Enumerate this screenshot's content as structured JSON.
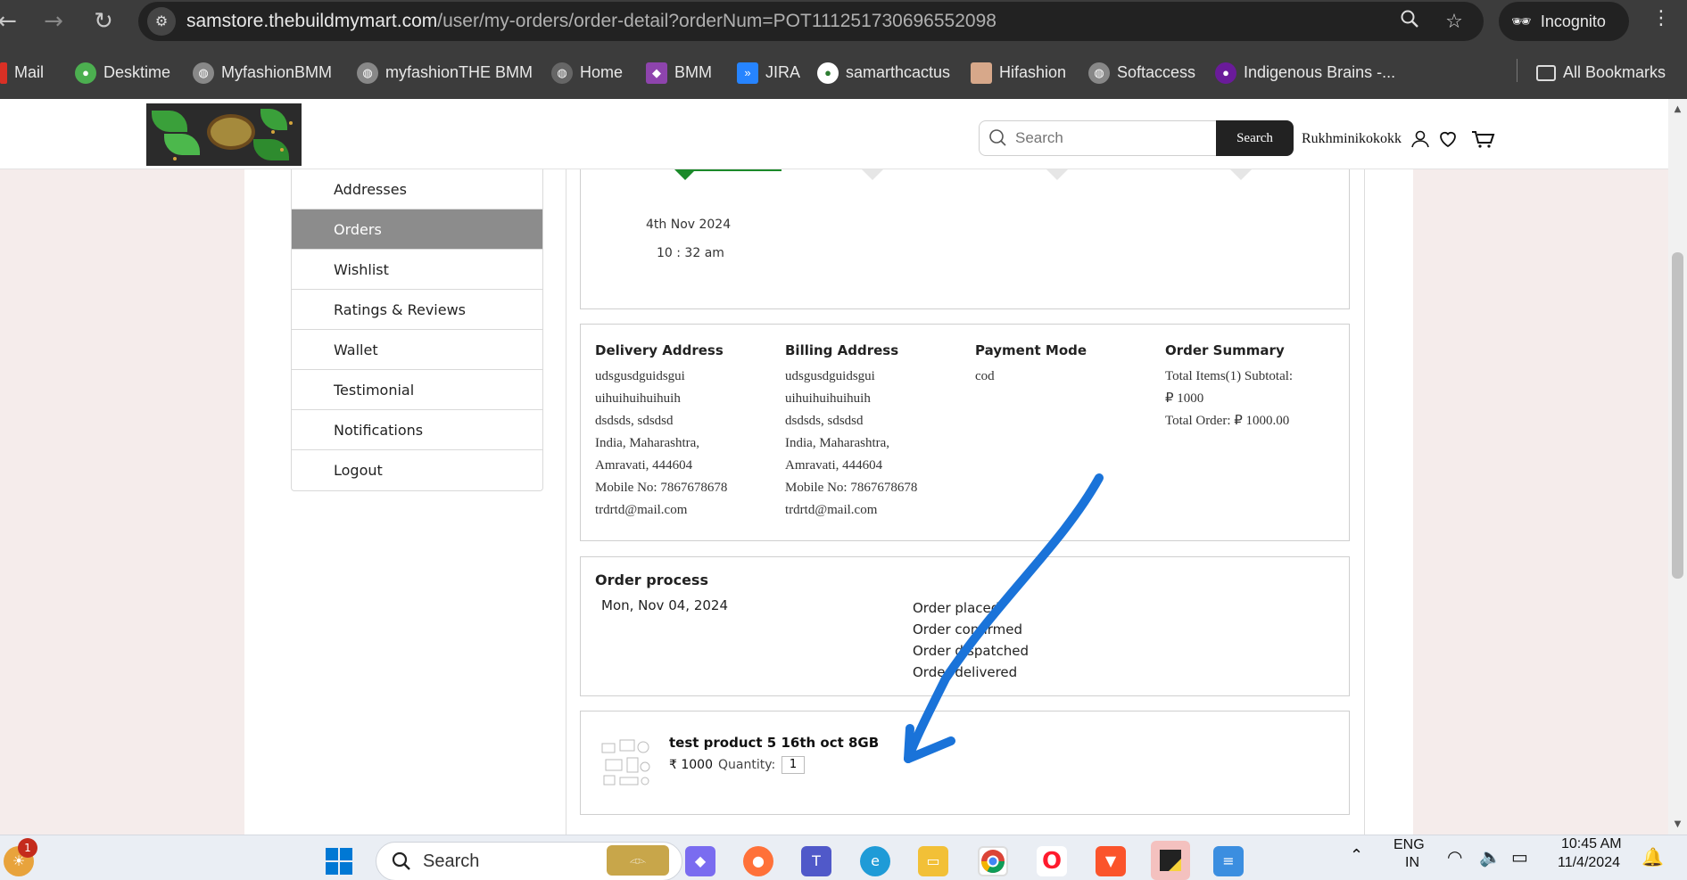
{
  "browser": {
    "url_host": "samstore.thebuildmymart.com",
    "url_path": "/user/my-orders/order-detail?orderNum=POT111251730696552098",
    "incognito_label": "Incognito",
    "bookmarks": [
      "Mail",
      "Desktime",
      "MyfashionBMM",
      "myfashionTHE BMM",
      "Home",
      "BMM",
      "JIRA",
      "samarthcactus",
      "Hifashion",
      "Softaccess",
      "Indigenous Brains -...",
      "All Bookmarks"
    ]
  },
  "header": {
    "search_placeholder": "Search",
    "search_button": "Search",
    "username": "Rukhminikokokk"
  },
  "sidebar": {
    "items": [
      {
        "label": "Addresses",
        "active": false
      },
      {
        "label": "Orders",
        "active": true
      },
      {
        "label": "Wishlist",
        "active": false
      },
      {
        "label": "Ratings & Reviews",
        "active": false
      },
      {
        "label": "Wallet",
        "active": false
      },
      {
        "label": "Testimonial",
        "active": false
      },
      {
        "label": "Notifications",
        "active": false
      },
      {
        "label": "Logout",
        "active": false
      }
    ]
  },
  "timeline": {
    "date": "4th Nov 2024",
    "time": "10 : 32 am"
  },
  "details": {
    "delivery": {
      "title": "Delivery Address",
      "lines": [
        "udsgusdguidsgui",
        "uihuihuihuihuih",
        "dsdsds, sdsdsd",
        "India, Maharashtra,",
        "Amravati, 444604",
        "Mobile No: 7867678678",
        "trdrtd@mail.com"
      ]
    },
    "billing": {
      "title": "Billing Address",
      "lines": [
        "udsgusdguidsgui",
        "uihuihuihuihuih",
        "dsdsds, sdsdsd",
        "India, Maharashtra,",
        "Amravati, 444604",
        "Mobile No: 7867678678",
        "trdrtd@mail.com"
      ]
    },
    "payment": {
      "title": "Payment Mode",
      "lines": [
        "cod"
      ]
    },
    "summary": {
      "title": "Order Summary",
      "lines": [
        "Total Items(1) Subtotal:",
        "₽ 1000",
        "Total Order: ₽ 1000.00"
      ]
    }
  },
  "process": {
    "title": "Order process",
    "date": "Mon, Nov 04, 2024",
    "steps": [
      "Order placed",
      "Order confirmed",
      "Order dispatched",
      "Order delivered"
    ]
  },
  "product": {
    "name": "test product 5 16th oct 8GB",
    "price": "₹ 1000",
    "qty_label": "Quantity:",
    "qty": "1"
  },
  "taskbar": {
    "search_label": "Search",
    "notification_count": "1",
    "lang": "ENG",
    "region": "IN",
    "time": "10:45 AM",
    "date": "11/4/2024"
  },
  "colors": {
    "accent_green": "#1b8a2a",
    "active_nav": "#8c8c8c",
    "annotation_arrow": "#1a73d9"
  }
}
